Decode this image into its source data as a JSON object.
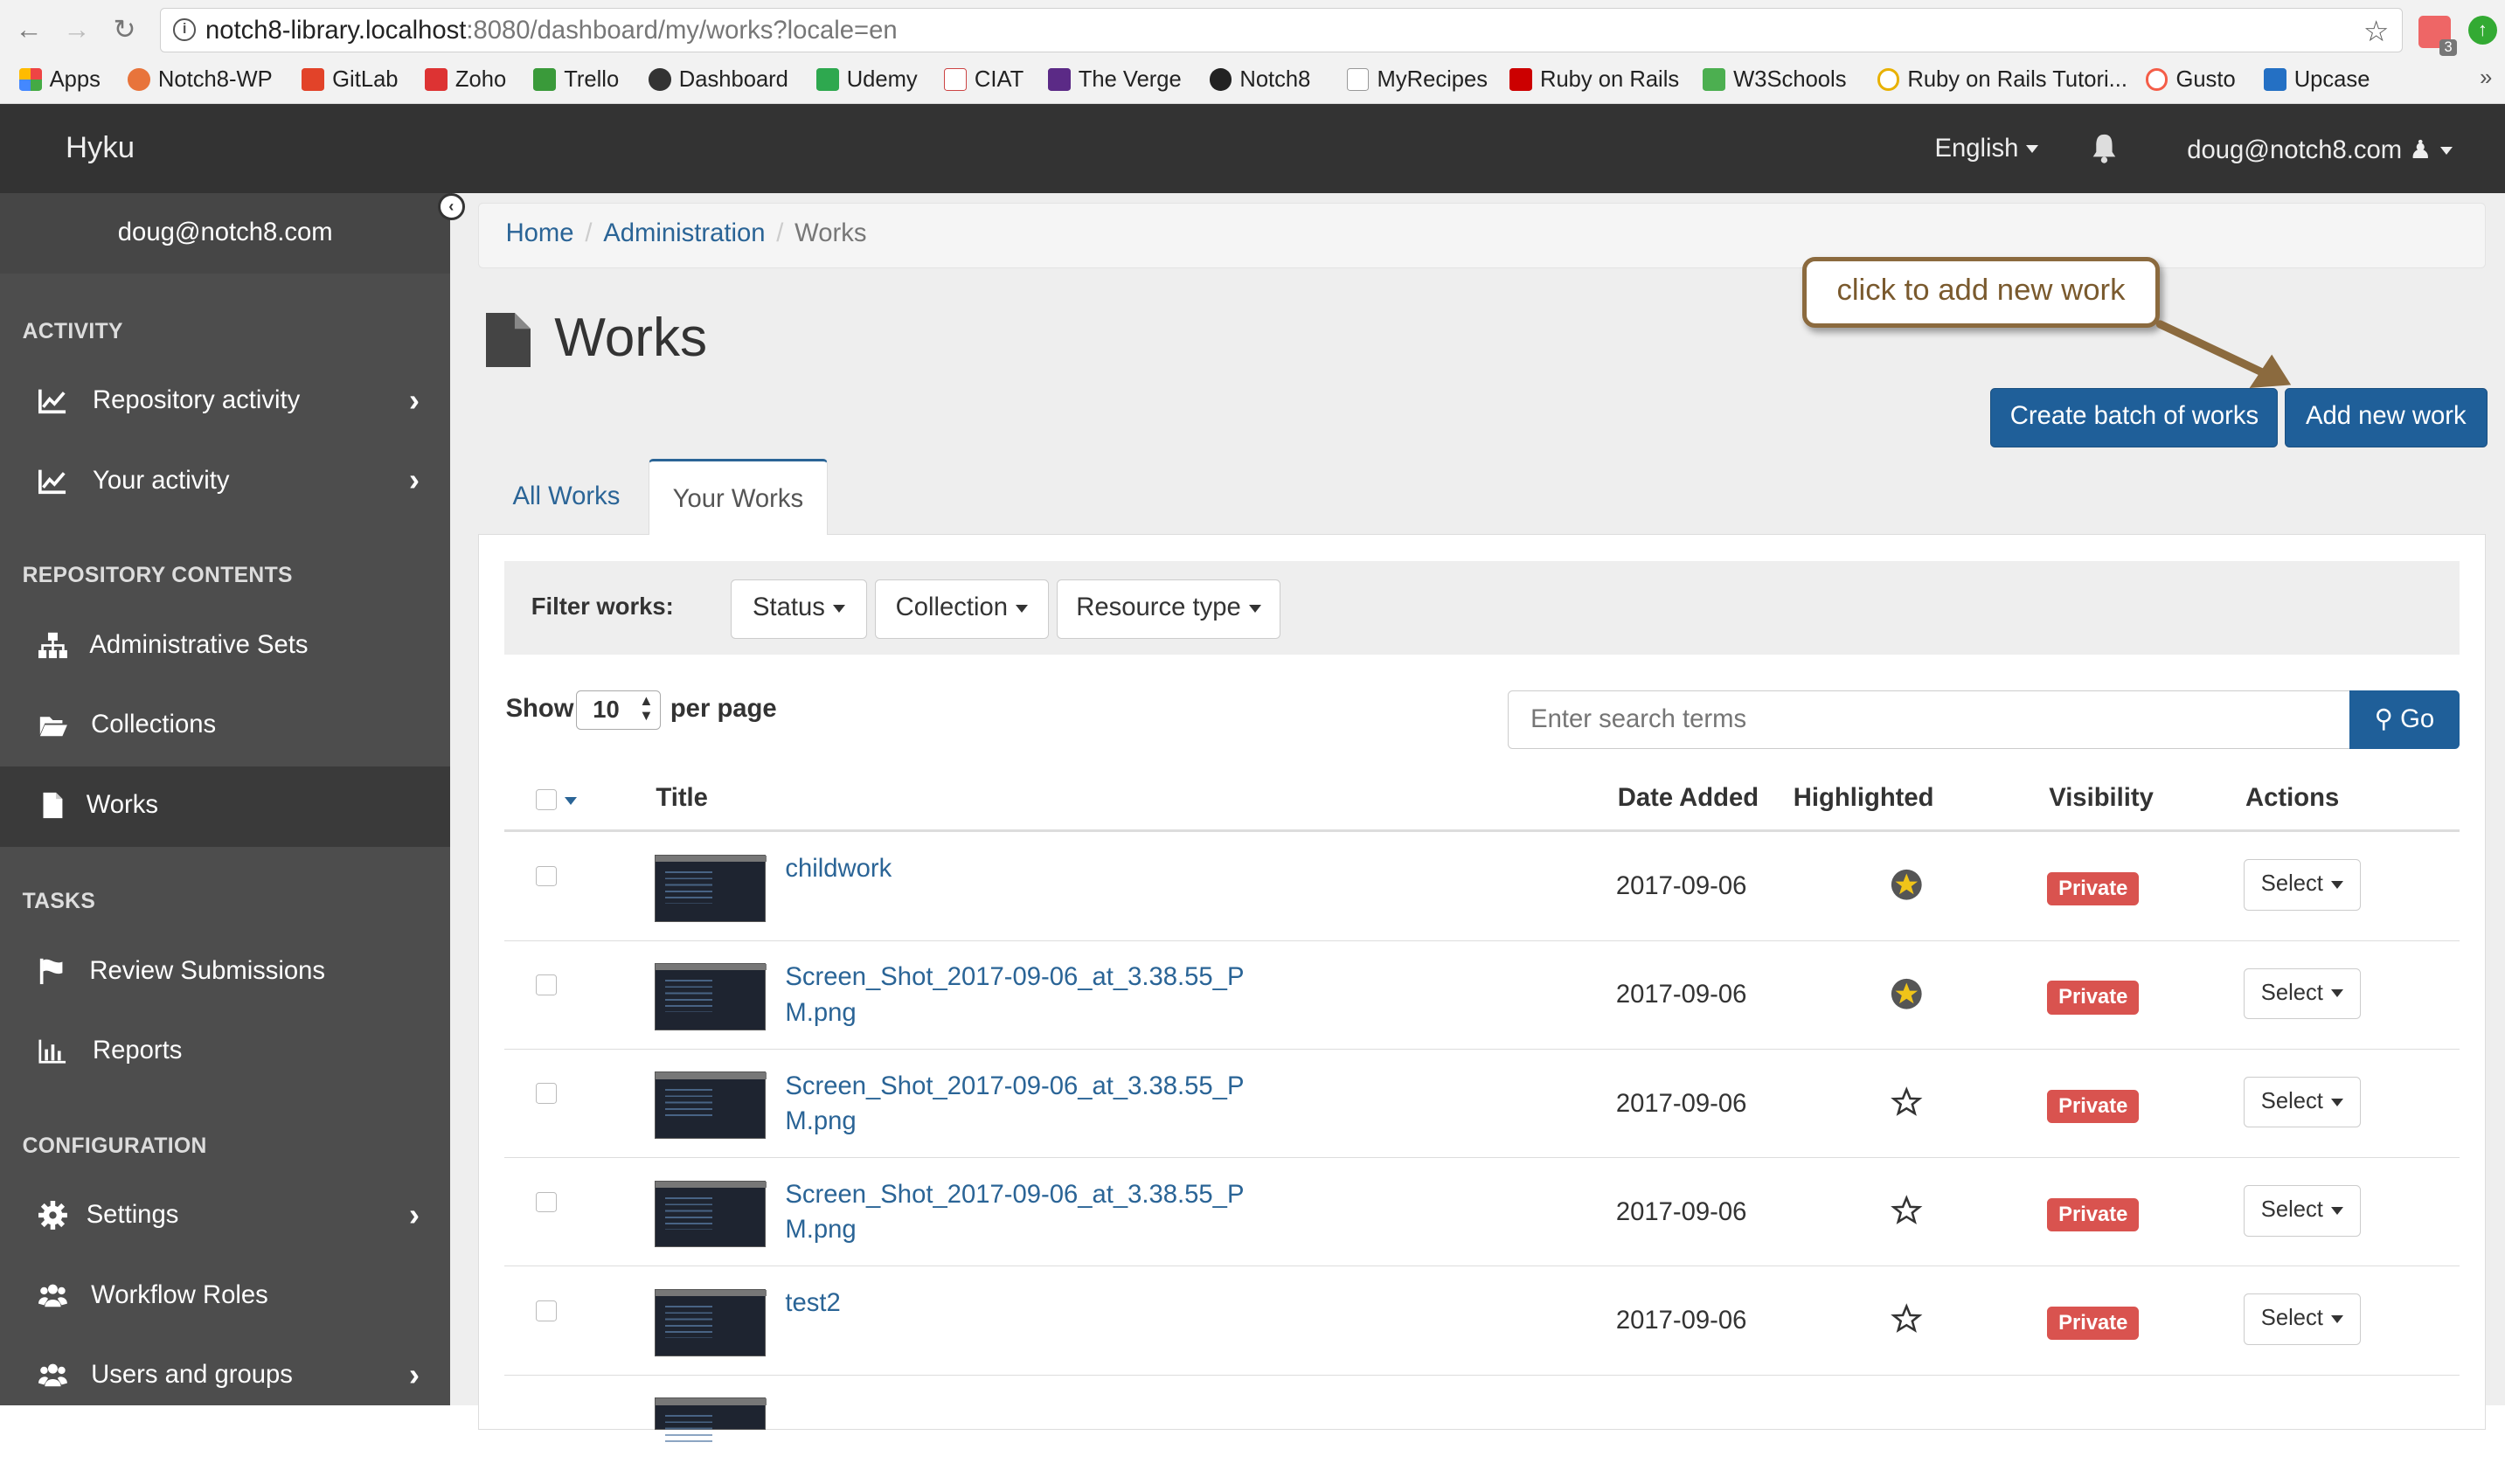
{
  "browser": {
    "url_host": "notch8-library.localhost",
    "url_rest": ":8080/dashboard/my/works?locale=en",
    "extension_badge": "3",
    "bookmarks": [
      "Apps",
      "Notch8-WP",
      "GitLab",
      "Zoho",
      "Trello",
      "Dashboard",
      "Udemy",
      "CIAT",
      "The Verge",
      "Notch8",
      "MyRecipes",
      "Ruby on Rails",
      "W3Schools",
      "Ruby on Rails Tutori...",
      "Gusto",
      "Upcase"
    ],
    "more": "»"
  },
  "header": {
    "brand": "Hyku",
    "language": "English",
    "user": "doug@notch8.com"
  },
  "sidebar": {
    "user": "doug@notch8.com",
    "sections": {
      "activity": "ACTIVITY",
      "repository": "REPOSITORY CONTENTS",
      "tasks": "TASKS",
      "configuration": "CONFIGURATION"
    },
    "items": {
      "repository_activity": "Repository activity",
      "your_activity": "Your activity",
      "admin_sets": "Administrative Sets",
      "collections": "Collections",
      "works": "Works",
      "review_submissions": "Review Submissions",
      "reports": "Reports",
      "settings": "Settings",
      "workflow_roles": "Workflow Roles",
      "users_groups": "Users and groups"
    }
  },
  "breadcrumb": {
    "home": "Home",
    "admin": "Administration",
    "current": "Works",
    "sep": "/"
  },
  "page": {
    "title": "Works",
    "callout": "click to add new work",
    "create_batch": "Create batch of works",
    "add_new": "Add new work"
  },
  "tabs": {
    "all": "All Works",
    "yours": "Your Works"
  },
  "filters": {
    "label": "Filter works:",
    "status": "Status",
    "collection": "Collection",
    "resource_type": "Resource type"
  },
  "paging": {
    "show": "Show",
    "per_page_value": "10",
    "per_page": "per page"
  },
  "search": {
    "placeholder": "Enter search terms",
    "go": "Go"
  },
  "table": {
    "headers": {
      "title": "Title",
      "date": "Date Added",
      "highlighted": "Highlighted",
      "visibility": "Visibility",
      "actions": "Actions"
    },
    "rows": [
      {
        "title": "childwork",
        "date": "2017-09-06",
        "highlighted": true,
        "visibility": "Private",
        "action": "Select"
      },
      {
        "title": "Screen_Shot_2017-09-06_at_3.38.55_PM.png",
        "date": "2017-09-06",
        "highlighted": true,
        "visibility": "Private",
        "action": "Select"
      },
      {
        "title": "Screen_Shot_2017-09-06_at_3.38.55_PM.png",
        "date": "2017-09-06",
        "highlighted": false,
        "visibility": "Private",
        "action": "Select"
      },
      {
        "title": "Screen_Shot_2017-09-06_at_3.38.55_PM.png",
        "date": "2017-09-06",
        "highlighted": false,
        "visibility": "Private",
        "action": "Select"
      },
      {
        "title": "test2",
        "date": "2017-09-06",
        "highlighted": false,
        "visibility": "Private",
        "action": "Select"
      }
    ]
  },
  "colors": {
    "primary": "#1f5f99",
    "link": "#2a6496",
    "danger": "#d9534f",
    "sidebar": "#4d4d4d",
    "header": "#333333",
    "star_fill": "#f0c419"
  }
}
